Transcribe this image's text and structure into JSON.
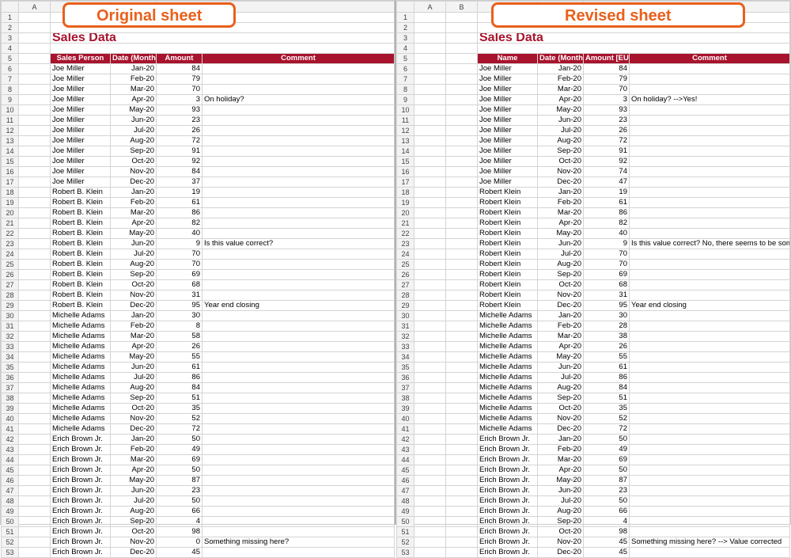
{
  "badges": {
    "left": "Original sheet",
    "right": "Revised sheet"
  },
  "title": "Sales Data",
  "left": {
    "col_letters": [
      "A"
    ],
    "headers": {
      "c1": "Sales Person",
      "c2": "Date (Month)",
      "c3": "Amount",
      "c4": "Comment"
    },
    "rows": [
      {
        "n": 6,
        "p": "Joe Miller",
        "d": "Jan-20",
        "a": 84,
        "c": ""
      },
      {
        "n": 7,
        "p": "Joe Miller",
        "d": "Feb-20",
        "a": 79,
        "c": ""
      },
      {
        "n": 8,
        "p": "Joe Miller",
        "d": "Mar-20",
        "a": 70,
        "c": ""
      },
      {
        "n": 9,
        "p": "Joe Miller",
        "d": "Apr-20",
        "a": 3,
        "c": "On holiday?"
      },
      {
        "n": 10,
        "p": "Joe Miller",
        "d": "May-20",
        "a": 93,
        "c": ""
      },
      {
        "n": 11,
        "p": "Joe Miller",
        "d": "Jun-20",
        "a": 23,
        "c": ""
      },
      {
        "n": 12,
        "p": "Joe Miller",
        "d": "Jul-20",
        "a": 26,
        "c": ""
      },
      {
        "n": 13,
        "p": "Joe Miller",
        "d": "Aug-20",
        "a": 72,
        "c": ""
      },
      {
        "n": 14,
        "p": "Joe Miller",
        "d": "Sep-20",
        "a": 91,
        "c": ""
      },
      {
        "n": 15,
        "p": "Joe Miller",
        "d": "Oct-20",
        "a": 92,
        "c": ""
      },
      {
        "n": 16,
        "p": "Joe Miller",
        "d": "Nov-20",
        "a": 84,
        "c": ""
      },
      {
        "n": 17,
        "p": "Joe Miller",
        "d": "Dec-20",
        "a": 37,
        "c": ""
      },
      {
        "n": 18,
        "p": "Robert B. Klein",
        "d": "Jan-20",
        "a": 19,
        "c": ""
      },
      {
        "n": 19,
        "p": "Robert B. Klein",
        "d": "Feb-20",
        "a": 61,
        "c": ""
      },
      {
        "n": 20,
        "p": "Robert B. Klein",
        "d": "Mar-20",
        "a": 86,
        "c": ""
      },
      {
        "n": 21,
        "p": "Robert B. Klein",
        "d": "Apr-20",
        "a": 82,
        "c": ""
      },
      {
        "n": 22,
        "p": "Robert B. Klein",
        "d": "May-20",
        "a": 40,
        "c": ""
      },
      {
        "n": 23,
        "p": "Robert B. Klein",
        "d": "Jun-20",
        "a": 9,
        "c": "Is this value correct?"
      },
      {
        "n": 24,
        "p": "Robert B. Klein",
        "d": "Jul-20",
        "a": 70,
        "c": ""
      },
      {
        "n": 25,
        "p": "Robert B. Klein",
        "d": "Aug-20",
        "a": 70,
        "c": ""
      },
      {
        "n": 26,
        "p": "Robert B. Klein",
        "d": "Sep-20",
        "a": 69,
        "c": ""
      },
      {
        "n": 27,
        "p": "Robert B. Klein",
        "d": "Oct-20",
        "a": 68,
        "c": ""
      },
      {
        "n": 28,
        "p": "Robert B. Klein",
        "d": "Nov-20",
        "a": 31,
        "c": ""
      },
      {
        "n": 29,
        "p": "Robert B. Klein",
        "d": "Dec-20",
        "a": 95,
        "c": "Year end closing"
      },
      {
        "n": 30,
        "p": "Michelle Adams",
        "d": "Jan-20",
        "a": 30,
        "c": ""
      },
      {
        "n": 31,
        "p": "Michelle Adams",
        "d": "Feb-20",
        "a": 8,
        "c": ""
      },
      {
        "n": 32,
        "p": "Michelle Adams",
        "d": "Mar-20",
        "a": 58,
        "c": ""
      },
      {
        "n": 33,
        "p": "Michelle Adams",
        "d": "Apr-20",
        "a": 26,
        "c": ""
      },
      {
        "n": 34,
        "p": "Michelle Adams",
        "d": "May-20",
        "a": 55,
        "c": ""
      },
      {
        "n": 35,
        "p": "Michelle Adams",
        "d": "Jun-20",
        "a": 61,
        "c": ""
      },
      {
        "n": 36,
        "p": "Michelle Adams",
        "d": "Jul-20",
        "a": 86,
        "c": ""
      },
      {
        "n": 37,
        "p": "Michelle Adams",
        "d": "Aug-20",
        "a": 84,
        "c": ""
      },
      {
        "n": 38,
        "p": "Michelle Adams",
        "d": "Sep-20",
        "a": 51,
        "c": ""
      },
      {
        "n": 39,
        "p": "Michelle Adams",
        "d": "Oct-20",
        "a": 35,
        "c": ""
      },
      {
        "n": 40,
        "p": "Michelle Adams",
        "d": "Nov-20",
        "a": 52,
        "c": ""
      },
      {
        "n": 41,
        "p": "Michelle Adams",
        "d": "Dec-20",
        "a": 72,
        "c": ""
      },
      {
        "n": 42,
        "p": "Erich Brown Jr.",
        "d": "Jan-20",
        "a": 50,
        "c": ""
      },
      {
        "n": 43,
        "p": "Erich Brown Jr.",
        "d": "Feb-20",
        "a": 49,
        "c": ""
      },
      {
        "n": 44,
        "p": "Erich Brown Jr.",
        "d": "Mar-20",
        "a": 69,
        "c": ""
      },
      {
        "n": 45,
        "p": "Erich Brown Jr.",
        "d": "Apr-20",
        "a": 50,
        "c": ""
      },
      {
        "n": 46,
        "p": "Erich Brown Jr.",
        "d": "May-20",
        "a": 87,
        "c": ""
      },
      {
        "n": 47,
        "p": "Erich Brown Jr.",
        "d": "Jun-20",
        "a": 23,
        "c": ""
      },
      {
        "n": 48,
        "p": "Erich Brown Jr.",
        "d": "Jul-20",
        "a": 50,
        "c": ""
      },
      {
        "n": 49,
        "p": "Erich Brown Jr.",
        "d": "Aug-20",
        "a": 66,
        "c": ""
      },
      {
        "n": 50,
        "p": "Erich Brown Jr.",
        "d": "Sep-20",
        "a": 4,
        "c": ""
      },
      {
        "n": 51,
        "p": "Erich Brown Jr.",
        "d": "Oct-20",
        "a": 98,
        "c": ""
      },
      {
        "n": 52,
        "p": "Erich Brown Jr.",
        "d": "Nov-20",
        "a": 0,
        "c": "Something missing here?"
      },
      {
        "n": 53,
        "p": "Erich Brown Jr.",
        "d": "Dec-20",
        "a": 45,
        "c": ""
      }
    ]
  },
  "right": {
    "col_letters": [
      "A",
      "B"
    ],
    "headers": {
      "c1": "Name",
      "c2": "Date (Month)",
      "c3": "Amount [EUR]",
      "c4": "Comment"
    },
    "rows": [
      {
        "n": 6,
        "p": "Joe Miller",
        "d": "Jan-20",
        "a": 84,
        "c": ""
      },
      {
        "n": 7,
        "p": "Joe Miller",
        "d": "Feb-20",
        "a": 79,
        "c": ""
      },
      {
        "n": 8,
        "p": "Joe Miller",
        "d": "Mar-20",
        "a": 70,
        "c": ""
      },
      {
        "n": 9,
        "p": "Joe Miller",
        "d": "Apr-20",
        "a": 3,
        "c": "On holiday? -->Yes!"
      },
      {
        "n": 10,
        "p": "Joe Miller",
        "d": "May-20",
        "a": 93,
        "c": ""
      },
      {
        "n": 11,
        "p": "Joe Miller",
        "d": "Jun-20",
        "a": 23,
        "c": ""
      },
      {
        "n": 12,
        "p": "Joe Miller",
        "d": "Jul-20",
        "a": 26,
        "c": ""
      },
      {
        "n": 13,
        "p": "Joe Miller",
        "d": "Aug-20",
        "a": 72,
        "c": ""
      },
      {
        "n": 14,
        "p": "Joe Miller",
        "d": "Sep-20",
        "a": 91,
        "c": ""
      },
      {
        "n": 15,
        "p": "Joe Miller",
        "d": "Oct-20",
        "a": 92,
        "c": ""
      },
      {
        "n": 16,
        "p": "Joe Miller",
        "d": "Nov-20",
        "a": 74,
        "c": ""
      },
      {
        "n": 17,
        "p": "Joe Miller",
        "d": "Dec-20",
        "a": 47,
        "c": ""
      },
      {
        "n": 18,
        "p": "Robert Klein",
        "d": "Jan-20",
        "a": 19,
        "c": ""
      },
      {
        "n": 19,
        "p": "Robert Klein",
        "d": "Feb-20",
        "a": 61,
        "c": ""
      },
      {
        "n": 20,
        "p": "Robert Klein",
        "d": "Mar-20",
        "a": 86,
        "c": ""
      },
      {
        "n": 21,
        "p": "Robert Klein",
        "d": "Apr-20",
        "a": 82,
        "c": ""
      },
      {
        "n": 22,
        "p": "Robert Klein",
        "d": "May-20",
        "a": 40,
        "c": ""
      },
      {
        "n": 23,
        "p": "Robert Klein",
        "d": "Jun-20",
        "a": 9,
        "c": "Is this value correct? No, there seems to be something missing"
      },
      {
        "n": 24,
        "p": "Robert Klein",
        "d": "Jul-20",
        "a": 70,
        "c": ""
      },
      {
        "n": 25,
        "p": "Robert Klein",
        "d": "Aug-20",
        "a": 70,
        "c": ""
      },
      {
        "n": 26,
        "p": "Robert Klein",
        "d": "Sep-20",
        "a": 69,
        "c": ""
      },
      {
        "n": 27,
        "p": "Robert Klein",
        "d": "Oct-20",
        "a": 68,
        "c": ""
      },
      {
        "n": 28,
        "p": "Robert Klein",
        "d": "Nov-20",
        "a": 31,
        "c": ""
      },
      {
        "n": 29,
        "p": "Robert Klein",
        "d": "Dec-20",
        "a": 95,
        "c": "Year end closing"
      },
      {
        "n": 30,
        "p": "Michelle Adams",
        "d": "Jan-20",
        "a": 30,
        "c": ""
      },
      {
        "n": 31,
        "p": "Michelle Adams",
        "d": "Feb-20",
        "a": 28,
        "c": ""
      },
      {
        "n": 32,
        "p": "Michelle Adams",
        "d": "Mar-20",
        "a": 38,
        "c": ""
      },
      {
        "n": 33,
        "p": "Michelle Adams",
        "d": "Apr-20",
        "a": 26,
        "c": ""
      },
      {
        "n": 34,
        "p": "Michelle Adams",
        "d": "May-20",
        "a": 55,
        "c": ""
      },
      {
        "n": 35,
        "p": "Michelle Adams",
        "d": "Jun-20",
        "a": 61,
        "c": ""
      },
      {
        "n": 36,
        "p": "Michelle Adams",
        "d": "Jul-20",
        "a": 86,
        "c": ""
      },
      {
        "n": 37,
        "p": "Michelle Adams",
        "d": "Aug-20",
        "a": 84,
        "c": ""
      },
      {
        "n": 38,
        "p": "Michelle Adams",
        "d": "Sep-20",
        "a": 51,
        "c": ""
      },
      {
        "n": 39,
        "p": "Michelle Adams",
        "d": "Oct-20",
        "a": 35,
        "c": ""
      },
      {
        "n": 40,
        "p": "Michelle Adams",
        "d": "Nov-20",
        "a": 52,
        "c": ""
      },
      {
        "n": 41,
        "p": "Michelle Adams",
        "d": "Dec-20",
        "a": 72,
        "c": ""
      },
      {
        "n": 42,
        "p": "Erich Brown Jr.",
        "d": "Jan-20",
        "a": 50,
        "c": ""
      },
      {
        "n": 43,
        "p": "Erich Brown Jr.",
        "d": "Feb-20",
        "a": 49,
        "c": ""
      },
      {
        "n": 44,
        "p": "Erich Brown Jr.",
        "d": "Mar-20",
        "a": 69,
        "c": ""
      },
      {
        "n": 45,
        "p": "Erich Brown Jr.",
        "d": "Apr-20",
        "a": 50,
        "c": ""
      },
      {
        "n": 46,
        "p": "Erich Brown Jr.",
        "d": "May-20",
        "a": 87,
        "c": ""
      },
      {
        "n": 47,
        "p": "Erich Brown Jr.",
        "d": "Jun-20",
        "a": 23,
        "c": ""
      },
      {
        "n": 48,
        "p": "Erich Brown Jr.",
        "d": "Jul-20",
        "a": 50,
        "c": ""
      },
      {
        "n": 49,
        "p": "Erich Brown Jr.",
        "d": "Aug-20",
        "a": 66,
        "c": ""
      },
      {
        "n": 50,
        "p": "Erich Brown Jr.",
        "d": "Sep-20",
        "a": 4,
        "c": ""
      },
      {
        "n": 51,
        "p": "Erich Brown Jr.",
        "d": "Oct-20",
        "a": 98,
        "c": ""
      },
      {
        "n": 52,
        "p": "Erich Brown Jr.",
        "d": "Nov-20",
        "a": 45,
        "c": "Something missing here? --> Value corrected"
      },
      {
        "n": 53,
        "p": "Erich Brown Jr.",
        "d": "Dec-20",
        "a": 45,
        "c": ""
      }
    ]
  }
}
